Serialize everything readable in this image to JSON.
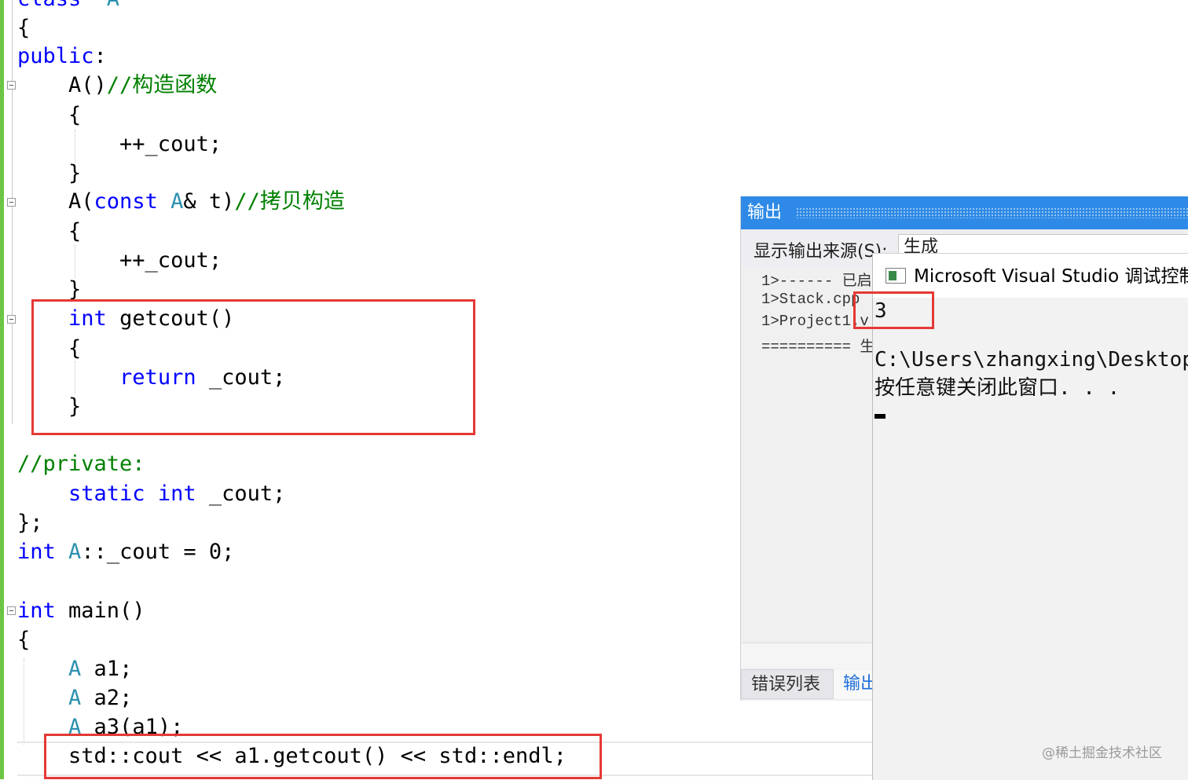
{
  "editor": {
    "lines": [
      {
        "segs": [
          [
            "kw",
            "class"
          ],
          [
            "",
            "  "
          ],
          [
            "ty",
            "A"
          ]
        ]
      },
      {
        "segs": [
          [
            "",
            "{"
          ]
        ]
      },
      {
        "segs": [
          [
            "kw",
            "public"
          ],
          [
            "",
            ":"
          ]
        ]
      },
      {
        "segs": [
          [
            "",
            "    A()"
          ],
          [
            "cm",
            "//构造函数"
          ]
        ]
      },
      {
        "segs": [
          [
            "",
            "    {"
          ]
        ]
      },
      {
        "segs": [
          [
            "",
            "        ++_cout;"
          ]
        ]
      },
      {
        "segs": [
          [
            "",
            "    }"
          ]
        ]
      },
      {
        "segs": [
          [
            "",
            "    A("
          ],
          [
            "kw",
            "const"
          ],
          [
            "",
            " "
          ],
          [
            "ty",
            "A"
          ],
          [
            "",
            "& "
          ],
          [
            "",
            "t)"
          ],
          [
            "cm",
            "//拷贝构造"
          ]
        ]
      },
      {
        "segs": [
          [
            "",
            "    {"
          ]
        ]
      },
      {
        "segs": [
          [
            "",
            "        ++_cout;"
          ]
        ]
      },
      {
        "segs": [
          [
            "",
            "    }"
          ]
        ]
      },
      {
        "segs": [
          [
            "",
            "    "
          ],
          [
            "kw",
            "int"
          ],
          [
            "",
            " getcout()"
          ]
        ]
      },
      {
        "segs": [
          [
            "",
            "    {"
          ]
        ]
      },
      {
        "segs": [
          [
            "",
            "        "
          ],
          [
            "kw",
            "return"
          ],
          [
            "",
            " _cout;"
          ]
        ]
      },
      {
        "segs": [
          [
            "",
            "    }"
          ]
        ]
      },
      {
        "segs": [
          [
            "",
            ""
          ]
        ]
      },
      {
        "segs": [
          [
            "cm",
            "//private:"
          ]
        ]
      },
      {
        "segs": [
          [
            "",
            "    "
          ],
          [
            "kw",
            "static"
          ],
          [
            "",
            " "
          ],
          [
            "kw",
            "int"
          ],
          [
            "",
            " _cout;"
          ]
        ]
      },
      {
        "segs": [
          [
            "",
            "};"
          ]
        ]
      },
      {
        "segs": [
          [
            "kw",
            "int"
          ],
          [
            "",
            " "
          ],
          [
            "ty",
            "A"
          ],
          [
            "",
            "::_cout = 0;"
          ]
        ]
      },
      {
        "segs": [
          [
            "",
            ""
          ]
        ]
      },
      {
        "segs": [
          [
            "kw",
            "int"
          ],
          [
            "",
            " main()"
          ]
        ]
      },
      {
        "segs": [
          [
            "",
            "{"
          ]
        ]
      },
      {
        "segs": [
          [
            "",
            "    "
          ],
          [
            "ty",
            "A"
          ],
          [
            "",
            " a1;"
          ]
        ]
      },
      {
        "segs": [
          [
            "",
            "    "
          ],
          [
            "ty",
            "A"
          ],
          [
            "",
            " a2;"
          ]
        ]
      },
      {
        "segs": [
          [
            "",
            "    "
          ],
          [
            "ty",
            "A"
          ],
          [
            "",
            " a3(a1);"
          ]
        ]
      },
      {
        "segs": [
          [
            "",
            "    std::cout << a1.getcout() << std::endl;"
          ]
        ]
      }
    ]
  },
  "output_panel": {
    "title": "输出",
    "source_label": "显示输出来源(S):",
    "source_value": "生成",
    "lines": [
      "1>------ 已启",
      "1>Stack.cpp",
      "1>Project1.v",
      "========== 生"
    ],
    "tabs": {
      "errors": "错误列表",
      "output": "输出"
    }
  },
  "console": {
    "title": "Microsoft Visual Studio 调试控制",
    "output_value": "3",
    "path_line": "C:\\Users\\zhangxing\\Desktop",
    "prompt_line": "按任意键关闭此窗口. . ."
  },
  "watermark": "@稀土掘金技术社区",
  "colors": {
    "keyword": "#0000ff",
    "type": "#2b91af",
    "comment": "#008000",
    "highlight_box": "#e53935",
    "output_title_bar": "#2e8ae6"
  }
}
